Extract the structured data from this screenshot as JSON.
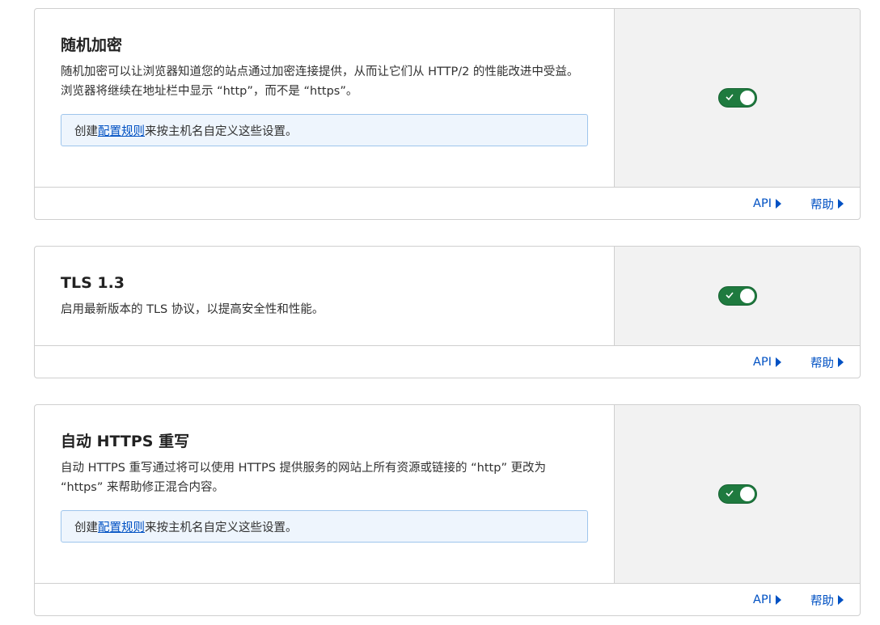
{
  "cards": [
    {
      "title": "随机加密",
      "description": "随机加密可以让浏览器知道您的站点通过加密连接提供，从而让它们从 HTTP/2 的性能改进中受益。浏览器将继续在地址栏中显示 “http”，而不是 “https”。",
      "info": {
        "prefix": "创建",
        "link": "配置规则",
        "suffix": "来按主机名自定义这些设置。"
      },
      "toggle_on": true,
      "footer": {
        "api": "API",
        "help": "帮助"
      }
    },
    {
      "title": "TLS 1.3",
      "description": "启用最新版本的 TLS 协议，以提高安全性和性能。",
      "toggle_on": true,
      "footer": {
        "api": "API",
        "help": "帮助"
      }
    },
    {
      "title": "自动 HTTPS 重写",
      "description": "自动 HTTPS 重写通过将可以使用 HTTPS 提供服务的网站上所有资源或链接的 “http” 更改为 “https” 来帮助修正混合内容。",
      "info": {
        "prefix": "创建",
        "link": "配置规则",
        "suffix": "来按主机名自定义这些设置。"
      },
      "toggle_on": true,
      "footer": {
        "api": "API",
        "help": "帮助"
      }
    }
  ],
  "colors": {
    "toggle_on": "#1f7a3f",
    "link": "#0051c3",
    "info_bg": "#eef5fd",
    "info_border": "#9ec5ec",
    "control_bg": "#f2f2f2"
  }
}
